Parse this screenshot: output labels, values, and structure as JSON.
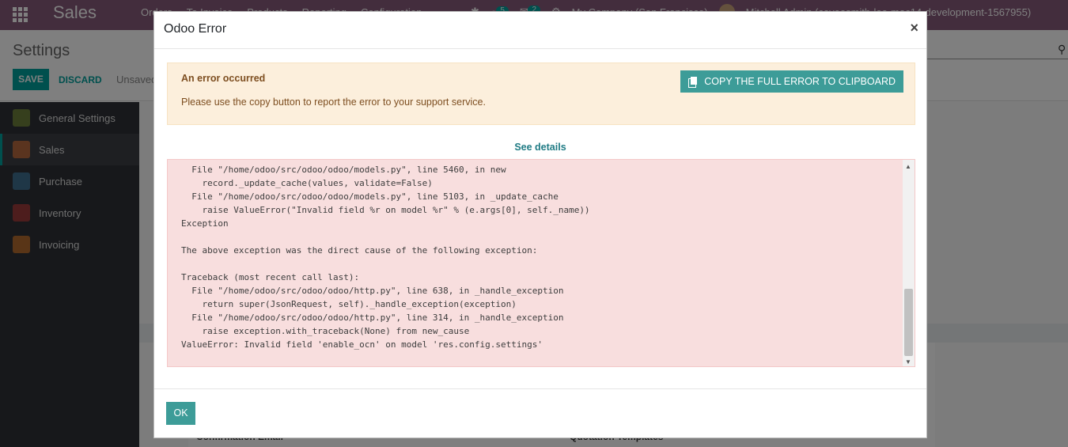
{
  "app": {
    "brand": "Sales",
    "menu": [
      "Orders",
      "To Invoice",
      "Products",
      "Reporting",
      "Configuration"
    ],
    "activity_count": "5",
    "message_count": "2",
    "company": "My Company (San Francisco)",
    "user": "Mitchell Admin (coveosmith-lee-mac14-development-1567955)"
  },
  "control_panel": {
    "title": "Settings",
    "save_label": "SAVE",
    "discard_label": "DISCARD",
    "unsaved_label": "Unsaved changes"
  },
  "sidebar": {
    "items": [
      {
        "label": "General Settings",
        "color": "#6c7f3a"
      },
      {
        "label": "Sales",
        "color": "#b4693f"
      },
      {
        "label": "Purchase",
        "color": "#3f6f8f"
      },
      {
        "label": "Inventory",
        "color": "#9b3a3a"
      },
      {
        "label": "Invoicing",
        "color": "#b36a2e"
      }
    ]
  },
  "background": {
    "confirmation_email": "Confirmation Email",
    "quotation_templates": "Quotation Templates"
  },
  "dialog": {
    "title": "Odoo Error",
    "close_glyph": "×",
    "alert_heading": "An error occurred",
    "alert_message": "Please use the copy button to report the error to your support service.",
    "copy_button": "COPY THE FULL ERROR TO CLIPBOARD",
    "see_details": "See details",
    "traceback": "  File \"/home/odoo/src/odoo/odoo/models.py\", line 5460, in new\n    record._update_cache(values, validate=False)\n  File \"/home/odoo/src/odoo/odoo/models.py\", line 5103, in _update_cache\n    raise ValueError(\"Invalid field %r on model %r\" % (e.args[0], self._name))\nException\n\nThe above exception was the direct cause of the following exception:\n\nTraceback (most recent call last):\n  File \"/home/odoo/src/odoo/odoo/http.py\", line 638, in _handle_exception\n    return super(JsonRequest, self)._handle_exception(exception)\n  File \"/home/odoo/src/odoo/odoo/http.py\", line 314, in _handle_exception\n    raise exception.with_traceback(None) from new_cause\nValueError: Invalid field 'enable_ocn' on model 'res.config.settings'",
    "ok_button": "OK"
  },
  "colors": {
    "topbar": "#875a7b",
    "accent": "#00a09d",
    "alert_bg": "#fcefdc",
    "trace_bg": "#f8dede"
  }
}
